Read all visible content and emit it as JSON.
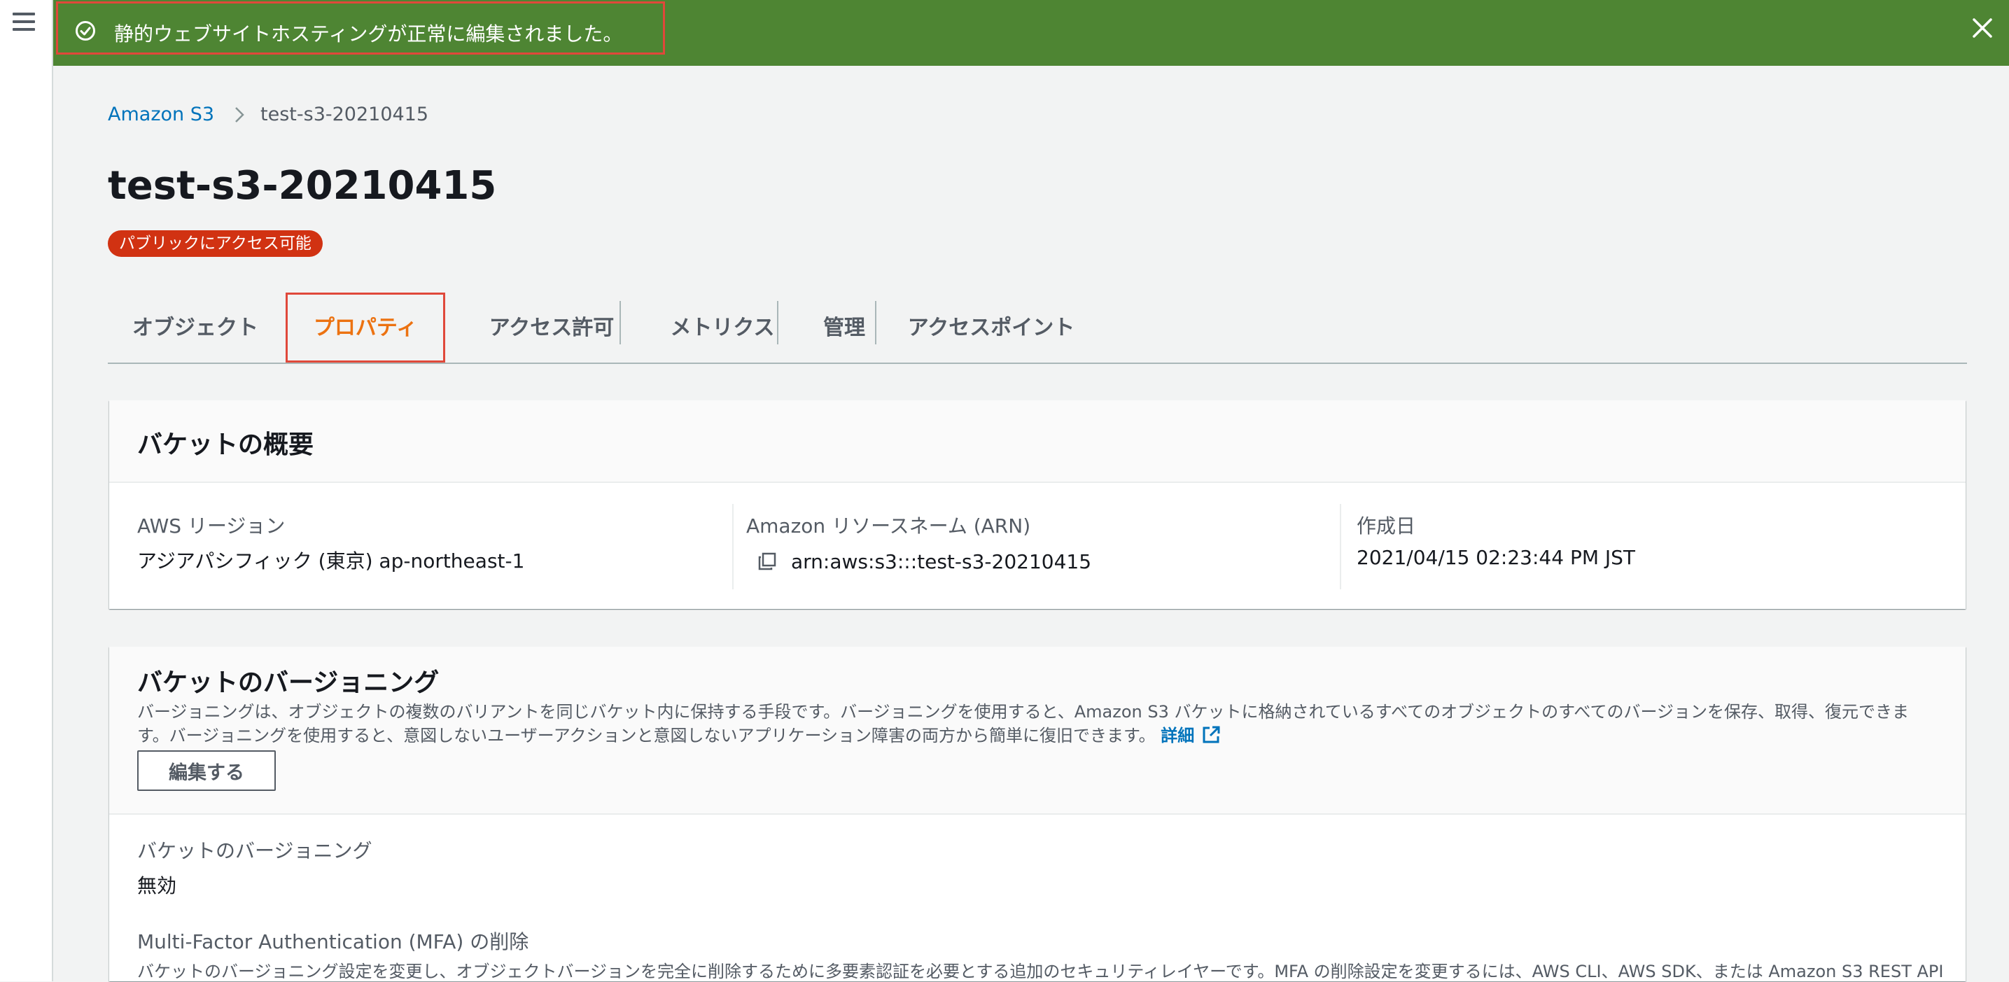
{
  "flash": {
    "message": "静的ウェブサイトホスティングが正常に編集されました。",
    "status_color": "#4e8533"
  },
  "breadcrumb": {
    "root": "Amazon S3",
    "current": "test-s3-20210415"
  },
  "bucket": {
    "name": "test-s3-20210415",
    "access_badge": "パブリックにアクセス可能"
  },
  "tabs": [
    {
      "label": "オブジェクト",
      "active": false
    },
    {
      "label": "プロパティ",
      "active": true
    },
    {
      "label": "アクセス許可",
      "active": false
    },
    {
      "label": "メトリクス",
      "active": false
    },
    {
      "label": "管理",
      "active": false
    },
    {
      "label": "アクセスポイント",
      "active": false
    }
  ],
  "overview": {
    "title": "バケットの概要",
    "region_label": "AWS リージョン",
    "region_value": "アジアパシフィック (東京) ap-northeast-1",
    "arn_label": "Amazon リソースネーム (ARN)",
    "arn_value": "arn:aws:s3:::test-s3-20210415",
    "created_label": "作成日",
    "created_value": "2021/04/15 02:23:44 PM JST"
  },
  "versioning": {
    "title": "バケットのバージョニング",
    "description_line1": "バージョニングは、オブジェクトの複数のバリアントを同じバケット内に保持する手段です。バージョニングを使用すると、Amazon S3 バケットに格納されているすべてのオブジェクトのすべてのバージョンを保存、取得、復元できま",
    "description_line2": "す。バージョニングを使用すると、意図しないユーザーアクションと意図しないアプリケーション障害の両方から簡単に復旧できます。",
    "details_link": "詳細",
    "edit_button": "編集する",
    "status_label": "バケットのバージョニング",
    "status_value": "無効",
    "mfa_label": "Multi-Factor Authentication (MFA) の削除",
    "mfa_description": "バケットのバージョニング設定を変更し、オブジェクトバージョンを完全に削除するために多要素認証を必要とする追加のセキュリティレイヤーです。MFA の削除設定を変更するには、AWS CLI、AWS SDK、または Amazon S3 REST API"
  },
  "colors": {
    "accent": "#ec7211",
    "link": "#0073bb",
    "badge": "#d13212",
    "highlight": "#e0483a"
  },
  "icons": [
    "menu-icon",
    "success-check-icon",
    "close-icon",
    "chevron-right-icon",
    "copy-icon",
    "external-link-icon"
  ]
}
